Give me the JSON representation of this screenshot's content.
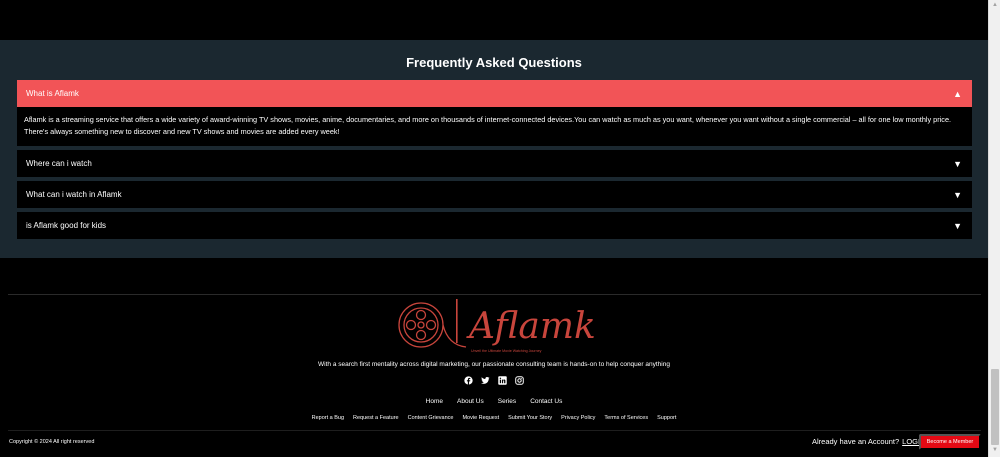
{
  "faq": {
    "title": "Frequently Asked Questions",
    "items": [
      {
        "question": "What is Aflamk",
        "expanded": true,
        "answer": "Aflamk is a streaming service that offers a wide variety of award-winning TV shows, movies, anime, documentaries, and more on thousands of internet-connected devices.You can watch as much as you want, whenever you want without a single commercial – all for one low monthly price. There's always something new to discover and new TV shows and movies are added every week!"
      },
      {
        "question": "Where can i watch",
        "expanded": false
      },
      {
        "question": "What can i watch in Aflamk",
        "expanded": false
      },
      {
        "question": "is Aflamk good for kids",
        "expanded": false
      }
    ]
  },
  "footer": {
    "logo_text": "Aflamk",
    "logo_subtitle": "Unveil the Ultimate Movie Watching Journey",
    "tagline": "With a search first mentality across digital marketing, our passionate consulting team is hands-on to help conquer anything",
    "social_icons": [
      "facebook-icon",
      "twitter-icon",
      "linkedin-icon",
      "instagram-icon"
    ],
    "nav": [
      "Home",
      "About Us",
      "Series",
      "Contact Us"
    ],
    "links": [
      "Report a Bug",
      "Request a Feature",
      "Content Grievance",
      "Movie Request",
      "Submit Your Story",
      "Privacy Policy",
      "Terms of Services",
      "Support"
    ],
    "copyright": "Copyright © 2024 All right reserved",
    "account_prompt": "Already have an Account?",
    "login_label": "LOGIN",
    "member_button": "Become a Member"
  },
  "colors": {
    "accent": "#f25457",
    "button_red": "#e50914",
    "section_bg": "#1b2830",
    "logo_red": "#c8453c"
  }
}
